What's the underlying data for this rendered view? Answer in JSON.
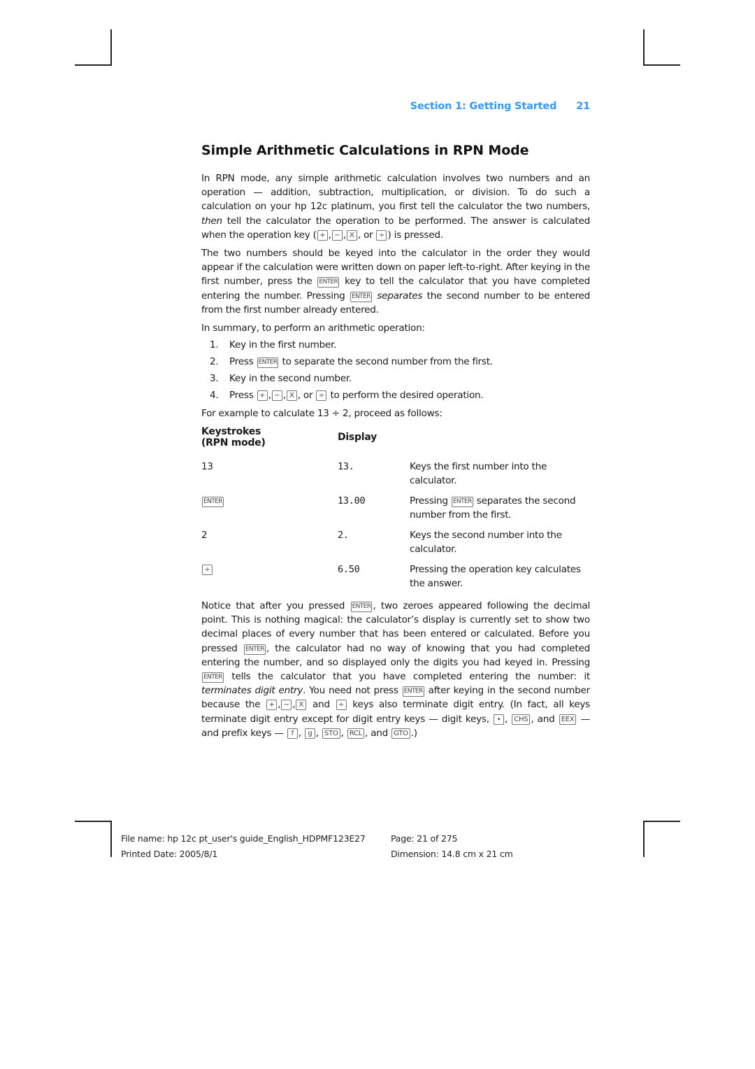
{
  "header": {
    "section": "Section 1: Getting Started",
    "page_number": "21",
    "accent_color": "#3399ff"
  },
  "title": "Simple Arithmetic Calculations in RPN Mode",
  "para1": {
    "t1": "In RPN mode, any simple arithmetic calculation involves two numbers and an operation — addition, subtraction, multiplication, or division. To do such a calculation on your hp 12c platinum, you first tell the calculator the two numbers, ",
    "em1": "then",
    "t2": " tell the calculator the operation to be performed. The answer is calculated when the operation key (",
    "t3": ", or ",
    "t4": ") is pressed."
  },
  "para2": {
    "t1": "The two numbers should be keyed into the calculator in the order they would appear if the calculation were written down on paper left-to-right. After keying in the first number, press the ",
    "t2": " key to tell the calculator that you have completed entering the number. Pressing ",
    "em1": "separates",
    "t3": " the second number to be entered from the first number already entered."
  },
  "summary_intro": "In summary, to perform an arithmetic operation:",
  "steps": [
    {
      "num": "1.",
      "text": "Key in the first number."
    },
    {
      "num": "2.",
      "pre": "Press ",
      "post": " to separate the second number from the first."
    },
    {
      "num": "3.",
      "text": "Key in the second number."
    },
    {
      "num": "4.",
      "pre": "Press ",
      "mid": ", or ",
      "post": " to perform the desired operation."
    }
  ],
  "example_intro": "For example to calculate 13 ÷ 2, proceed as follows:",
  "table": {
    "headers": {
      "keystrokes_line1": "Keystrokes",
      "keystrokes_line2": "(RPN mode)",
      "display": "Display"
    },
    "rows": [
      {
        "keystrokes": "13",
        "display": "13.",
        "description": "Keys the first number into the calculator."
      },
      {
        "keystrokes_key": "ENTER",
        "display": "13.00",
        "desc_pre": "Pressing ",
        "desc_post": " separates the second number from the first."
      },
      {
        "keystrokes": "2",
        "display": "2.",
        "description": "Keys the second number into the calculator."
      },
      {
        "keystrokes_key": "÷",
        "display": "6.50",
        "description": "Pressing the operation key calculates the answer."
      }
    ]
  },
  "para3": {
    "t1": "Notice that after you pressed ",
    "t2": ", two zeroes appeared following the decimal point. This is nothing magical: the calculator’s display is currently set to show two decimal places of every number that has been entered or calculated. Before you pressed ",
    "t3": ", the calculator had no way of knowing that you had completed entering the number, and so displayed only the digits you had keyed in. Pressing ",
    "t4": " tells the calculator that you have completed entering the number: it ",
    "em1": "terminates digit entry",
    "t5": ". You need not press ",
    "t6": " after keying in the second number because the ",
    "t7": " and ",
    "t8": " keys also terminate digit entry. (In fact, all keys terminate digit entry except for digit entry keys — digit keys, ",
    "t9": ", and ",
    "t10": " — and prefix keys — ",
    "t11": ", and ",
    "t12": ".)",
    "sep": ", "
  },
  "keys": {
    "plus": "+",
    "minus": "−",
    "times": "X",
    "divide": "÷",
    "enter": "ENTER",
    "dot": "•",
    "chs": "CHS",
    "eex": "EEX",
    "f": "f",
    "g": "g",
    "sto": "STO",
    "rcl": "RCL",
    "gto": "GTO"
  },
  "footer": {
    "file_name": "File name: hp 12c pt_user's guide_English_HDPMF123E27",
    "page": "Page: 21 of 275",
    "printed_date": "Printed Date: 2005/8/1",
    "dimension": "Dimension: 14.8 cm x 21 cm"
  }
}
